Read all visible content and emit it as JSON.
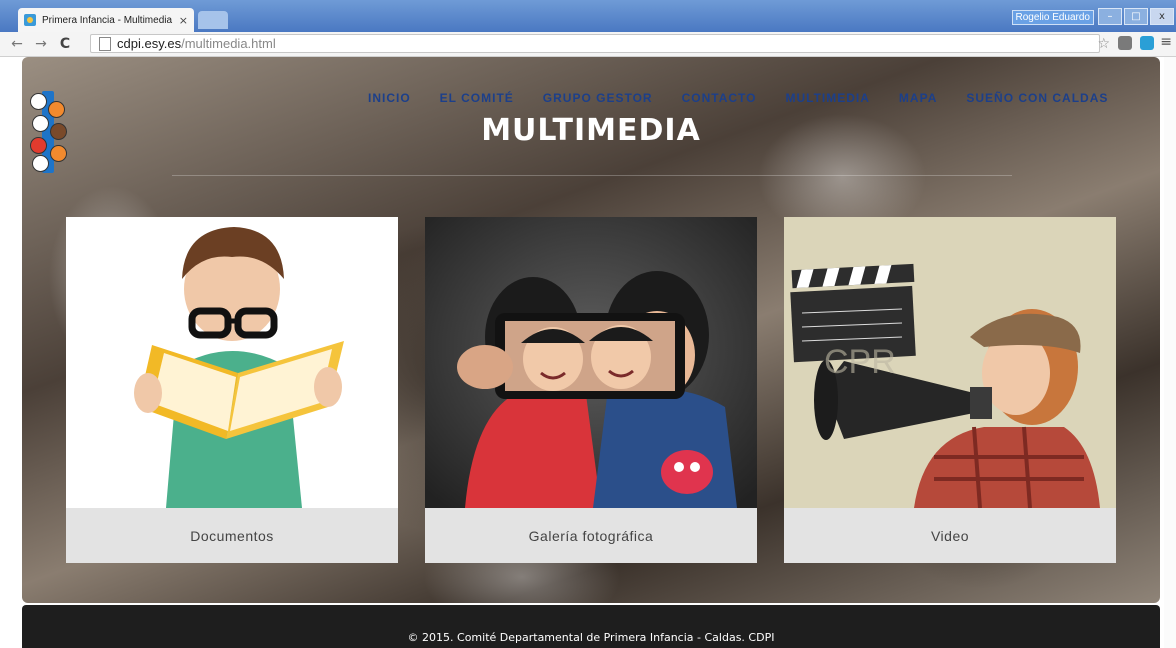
{
  "browser": {
    "tab_title": "Primera Infancia - Multimedia",
    "tab_close": "×",
    "user_name": "Rogelio Eduardo",
    "window_buttons": [
      "–",
      "□",
      "x"
    ],
    "url_host": "cdpi.esy.es",
    "url_path": "/multimedia.html",
    "nav": {
      "back": "←",
      "forward": "→",
      "reload": "C",
      "menu": "≡",
      "star": "☆"
    }
  },
  "site": {
    "nav_items": [
      "INICIO",
      "EL COMITÉ",
      "GRUPO GESTOR",
      "CONTACTO",
      "MULTIMEDIA",
      "MAPA",
      "SUEÑO CON CALDAS"
    ],
    "page_title": "MULTIMEDIA",
    "cards": [
      {
        "caption": "Documentos",
        "image": "child-reading-book"
      },
      {
        "caption": "Galería fotográfica",
        "image": "children-selfie-phone"
      },
      {
        "caption": "Video",
        "image": "child-megaphone-clapperboard"
      }
    ],
    "footer": "© 2015. Comité Departamental de Primera Infancia - Caldas. CDPI"
  },
  "colors": {
    "nav_link": "#1c3f8a",
    "footer_bg": "#1e1e1e",
    "caption_bg": "#e3e3e3",
    "titlebar": "#4a78c2"
  }
}
